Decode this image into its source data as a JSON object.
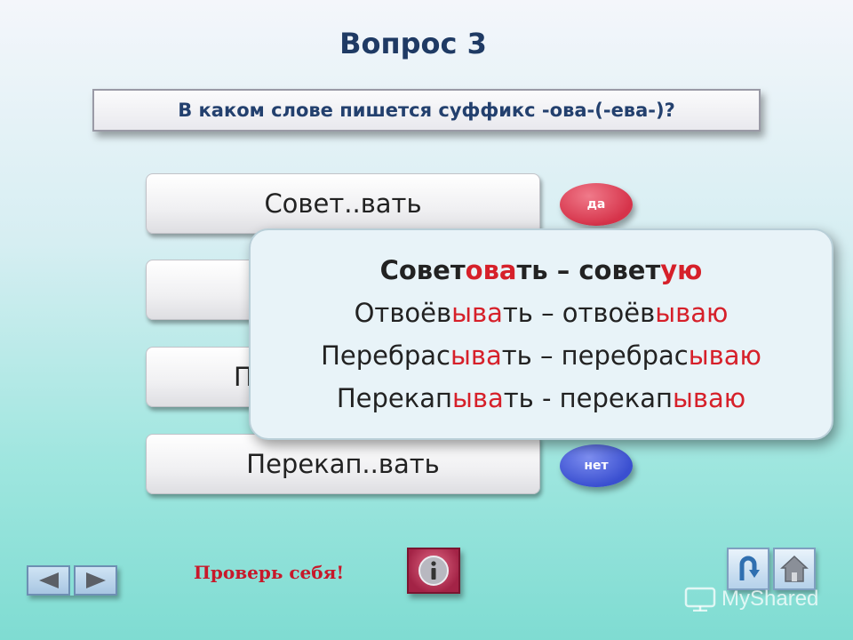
{
  "title": "Вопрос 3",
  "question": "В каком слове пишется суффикс -ова-(-ева-)?",
  "words": [
    {
      "label": "Совет..вать",
      "visible_text": "Совет..вать"
    },
    {
      "label": "",
      "visible_text": ""
    },
    {
      "label": "П",
      "visible_text": "П"
    },
    {
      "label": "Перекап..вать",
      "visible_text": "Перекап..вать"
    }
  ],
  "badges": {
    "yes": "да",
    "no": "нет"
  },
  "popup": {
    "lines": [
      {
        "parts": [
          "Совет",
          "ова",
          "ть – совет",
          "ую"
        ]
      },
      {
        "parts": [
          "Отвоёв",
          "ыва",
          "ть – отвоёв",
          "ываю"
        ]
      },
      {
        "parts": [
          "Перебрас",
          "ыва",
          "ть – перебрас",
          "ываю"
        ]
      },
      {
        "parts": [
          "Перекап",
          "ыва",
          "ть - перекап",
          "ываю"
        ]
      }
    ]
  },
  "footer": {
    "check_label": "Проверь себя!",
    "watermark": "MyShared"
  },
  "icons": {
    "prev": "arrow-left-icon",
    "next": "arrow-right-icon",
    "info": "info-icon",
    "back": "return-arrow-icon",
    "home": "home-icon"
  },
  "colors": {
    "title": "#1f3a64",
    "highlight": "#d6202a",
    "yes_badge": "#d6334a",
    "no_badge": "#3a4fd0"
  }
}
